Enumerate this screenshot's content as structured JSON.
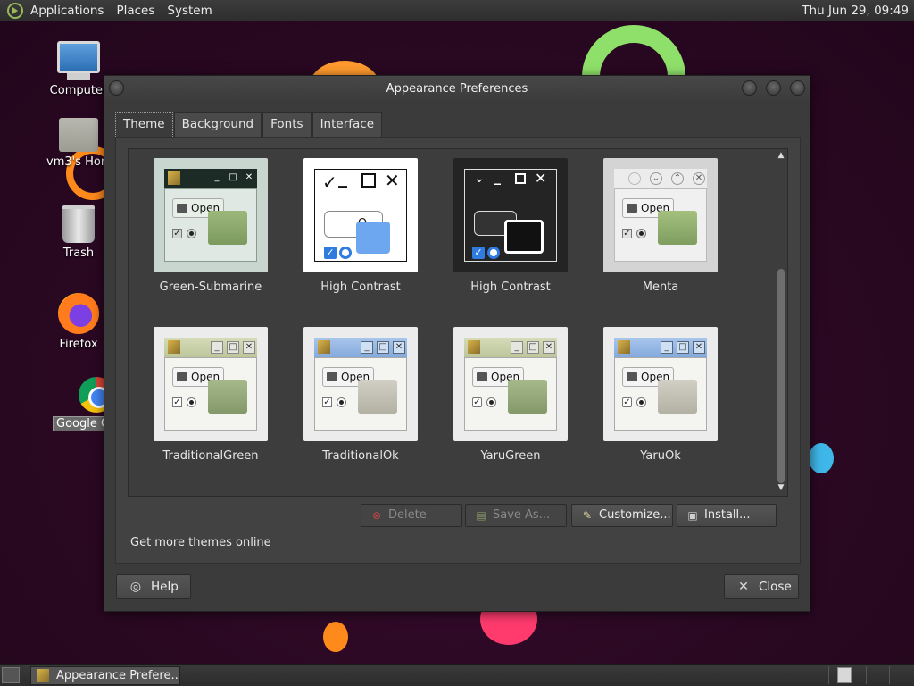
{
  "top_panel": {
    "menus": [
      "Applications",
      "Places",
      "System"
    ],
    "clock": "Thu Jun 29, 09:49"
  },
  "desktop_icons": [
    {
      "label": "Computer",
      "icon": "computer-icon"
    },
    {
      "label": "vm3's Home",
      "icon": "home-folder-icon"
    },
    {
      "label": "Trash",
      "icon": "trash-icon"
    },
    {
      "label": "Firefox",
      "icon": "firefox-icon"
    },
    {
      "label": "Google Chrome",
      "icon": "chrome-icon"
    }
  ],
  "dialog": {
    "title": "Appearance Preferences",
    "tabs": [
      "Theme",
      "Background",
      "Fonts",
      "Interface"
    ],
    "active_tab": "Theme",
    "themes": [
      {
        "name": "Green-Submarine"
      },
      {
        "name": "High Contrast"
      },
      {
        "name": "High Contrast"
      },
      {
        "name": "Menta"
      },
      {
        "name": "TraditionalGreen"
      },
      {
        "name": "TraditionalOk"
      },
      {
        "name": "YaruGreen"
      },
      {
        "name": "YaruOk"
      }
    ],
    "open_label": "Open",
    "buttons": {
      "delete": "Delete",
      "save_as": "Save As...",
      "customize": "Customize...",
      "install": "Install..."
    },
    "more_themes": "Get more themes online",
    "help": "Help",
    "close": "Close"
  },
  "taskbar": {
    "task_label": "Appearance Prefere..."
  },
  "colors": {
    "panel_bg": "#3a3a3a",
    "dialog_bg": "#3b3b3b",
    "accent_blue": "#2f7be0",
    "wallpaper": "#2b0a25"
  }
}
